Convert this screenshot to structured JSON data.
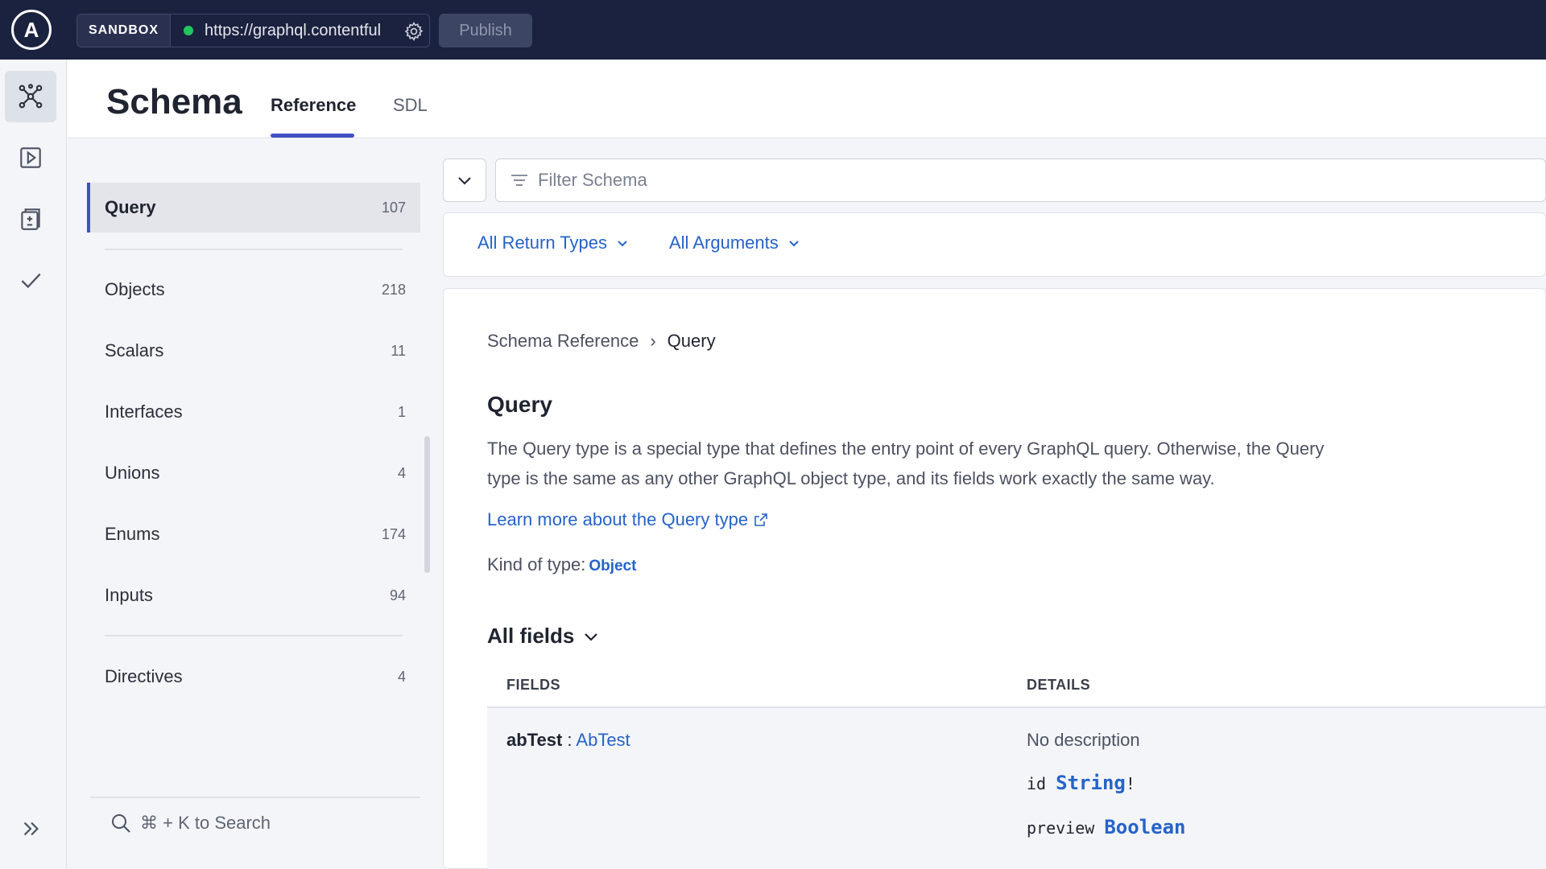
{
  "topbar": {
    "logo_letter": "A",
    "sandbox_label": "SANDBOX",
    "url": "https://graphql.contentful.c",
    "publish_label": "Publish",
    "status_color": "#22c55e"
  },
  "rail": {
    "items": [
      "schema-icon",
      "play-icon",
      "document-diff-icon",
      "checkmark-icon"
    ],
    "expand_icon": "double-chevron-right-icon"
  },
  "header": {
    "title": "Schema",
    "tabs": [
      {
        "label": "Reference",
        "active": true
      },
      {
        "label": "SDL",
        "active": false
      }
    ]
  },
  "sidebar": {
    "items": [
      {
        "label": "Query",
        "count": "107",
        "active": true
      },
      {
        "label": "Objects",
        "count": "218"
      },
      {
        "label": "Scalars",
        "count": "11"
      },
      {
        "label": "Interfaces",
        "count": "1"
      },
      {
        "label": "Unions",
        "count": "4"
      },
      {
        "label": "Enums",
        "count": "174"
      },
      {
        "label": "Inputs",
        "count": "94"
      },
      {
        "label": "Directives",
        "count": "4"
      }
    ],
    "search_hint": "⌘ + K to Search"
  },
  "filter": {
    "placeholder": "Filter Schema",
    "return_types": "All Return Types",
    "arguments": "All Arguments"
  },
  "content": {
    "breadcrumb": [
      "Schema Reference",
      "Query"
    ],
    "title": "Query",
    "description_1": "The Query type is a special type that defines the entry point of every GraphQL query. Otherwise, the Query",
    "description_2": "type is the same as any other GraphQL object type, and its fields work exactly the same way.",
    "learn_more": "Learn more about the Query type",
    "kind_label": "Kind of type:",
    "kind_value": "Object",
    "all_fields": "All fields",
    "columns": [
      "FIELDS",
      "DETAILS"
    ],
    "field": {
      "name": "abTest",
      "sep": " : ",
      "type": "AbTest",
      "description": "No description",
      "args": [
        {
          "name": "id",
          "type": "String",
          "suffix": "!"
        },
        {
          "name": "preview",
          "type": "Boolean",
          "suffix": ""
        }
      ]
    }
  },
  "colors": {
    "topbar": "#1b2240",
    "accent": "#3f51c4",
    "link": "#2563c9"
  }
}
